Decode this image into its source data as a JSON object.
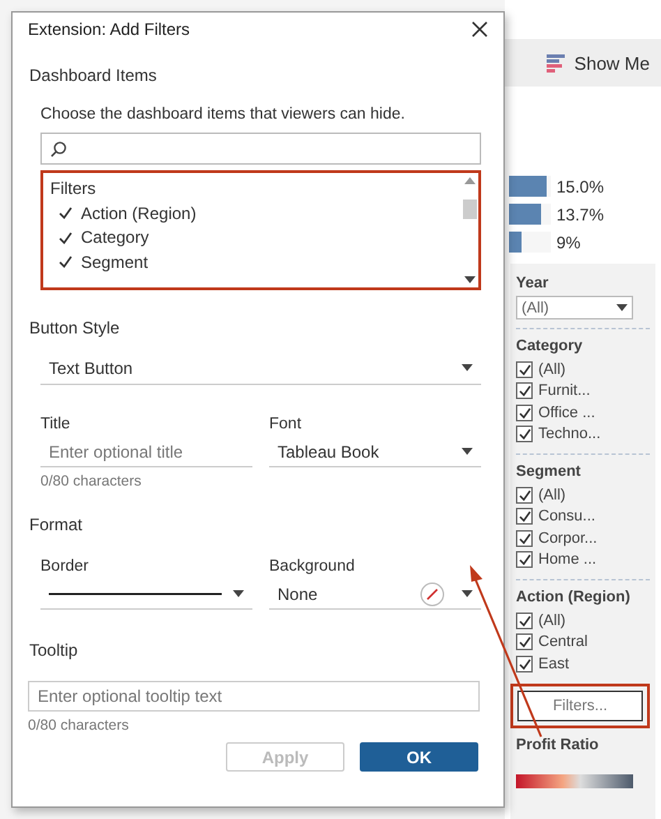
{
  "workspace": {
    "show_me": "Show Me",
    "bars": [
      {
        "reading": "15.0%",
        "level": 0.9
      },
      {
        "reading": "13.7%",
        "level": 0.75
      },
      {
        "reading": "9%",
        "level": 0.3
      }
    ],
    "filters": [
      {
        "kind": "dropdown",
        "title": "Year",
        "value": "(All)"
      },
      {
        "kind": "checklist",
        "title": "Category",
        "items": [
          {
            "label": "(All)",
            "checked": true
          },
          {
            "label": "Furnit...",
            "checked": true
          },
          {
            "label": "Office ...",
            "checked": true
          },
          {
            "label": "Techno...",
            "checked": true
          }
        ]
      },
      {
        "kind": "checklist",
        "title": "Segment",
        "items": [
          {
            "label": "(All)",
            "checked": true
          },
          {
            "label": "Consu...",
            "checked": true
          },
          {
            "label": "Corpor...",
            "checked": true
          },
          {
            "label": "Home ...",
            "checked": true
          }
        ]
      },
      {
        "kind": "checklist",
        "title": "Action (Region)",
        "items": [
          {
            "label": "(All)",
            "checked": true
          },
          {
            "label": "Central",
            "checked": true
          },
          {
            "label": "East",
            "checked": true
          }
        ]
      }
    ],
    "filters_button": "Filters...",
    "legend_title": "Profit Ratio"
  },
  "dialog": {
    "title": "Extension: Add Filters",
    "dashboard_items": {
      "heading": "Dashboard Items",
      "description": "Choose the dashboard items that viewers can hide.",
      "group": "Filters",
      "items": [
        {
          "label": "Action (Region)",
          "checked": true
        },
        {
          "label": "Category",
          "checked": true
        },
        {
          "label": "Segment",
          "checked": true
        }
      ]
    },
    "button_style": {
      "heading": "Button Style",
      "style": "Text Button",
      "title_label": "Title",
      "title_placeholder": "Enter optional title",
      "title_counter": "0/80 characters",
      "font_label": "Font",
      "font": "Tableau Book"
    },
    "format": {
      "heading": "Format",
      "border_label": "Border",
      "background_label": "Background",
      "background": "None"
    },
    "tooltip": {
      "heading": "Tooltip",
      "placeholder": "Enter optional tooltip text",
      "counter": "0/80 characters"
    },
    "buttons": [
      {
        "label": "Apply",
        "kind": "secondary",
        "disabled": true
      },
      {
        "label": "OK",
        "kind": "primary",
        "disabled": false
      }
    ]
  }
}
